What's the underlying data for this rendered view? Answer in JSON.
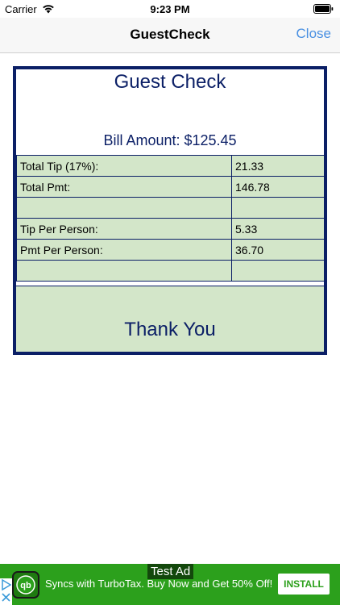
{
  "status_bar": {
    "carrier": "Carrier",
    "time": "9:23 PM"
  },
  "nav": {
    "title": "GuestCheck",
    "close_label": "Close"
  },
  "receipt": {
    "title": "Guest Check",
    "bill_amount": "Bill Amount: $125.45",
    "rows": [
      {
        "label": "Total Tip (17%):",
        "value": "21.33"
      },
      {
        "label": "Total Pmt:",
        "value": "146.78"
      },
      {
        "label": "",
        "value": ""
      },
      {
        "label": "Tip Per Person:",
        "value": "5.33"
      },
      {
        "label": "Pmt Per Person:",
        "value": "36.70"
      },
      {
        "label": "",
        "value": ""
      }
    ],
    "footer": "Thank You"
  },
  "ad": {
    "badge": "Test Ad",
    "text": "Syncs with TurboTax. Buy Now and Get 50% Off!",
    "install_label": "INSTALL",
    "logo_icon": "quickbooks-logo-icon"
  },
  "colors": {
    "accent": "#4a90e2",
    "navy": "#0b1f66",
    "table_fill": "#d3e6c9",
    "ad_green": "#2ca01c"
  }
}
